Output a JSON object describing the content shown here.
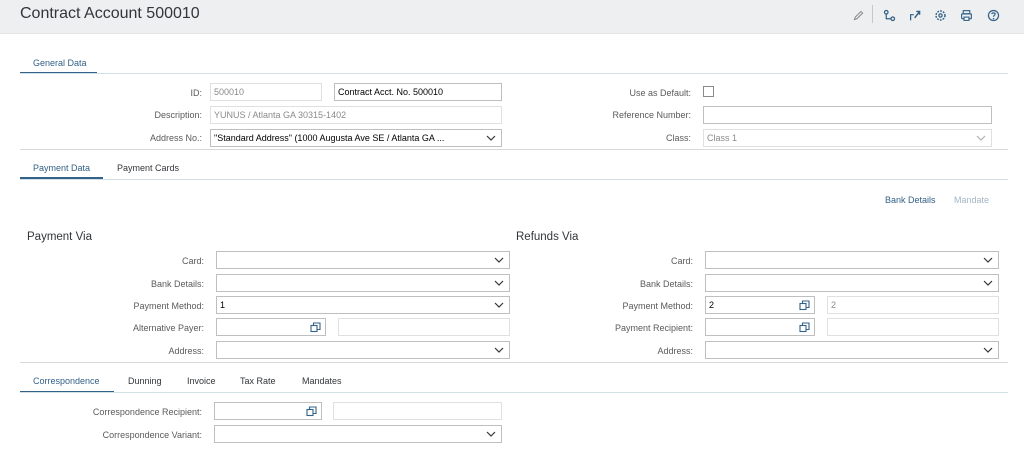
{
  "header": {
    "title": "Contract Account 500010",
    "icons": [
      "edit-icon",
      "hierarchy-icon",
      "share-icon",
      "settings-icon",
      "print-icon",
      "help-icon"
    ]
  },
  "general_section": {
    "tab": "General Data",
    "id_label": "ID:",
    "id_value": "500010",
    "name_value": "Contract Acct. No. 500010",
    "description_label": "Description:",
    "description_value": "YUNUS / Atlanta GA 30315-1402",
    "address_label": "Address No.:",
    "address_value": "\"Standard Address\"  (1000 Augusta Ave SE / Atlanta GA ...",
    "use_default_label": "Use as Default:",
    "reference_label": "Reference Number:",
    "reference_value": "",
    "class_label": "Class:",
    "class_value": "Class 1"
  },
  "payment_tabs": [
    "Payment Data",
    "Payment Cards"
  ],
  "payment_links": {
    "bank_details": "Bank Details",
    "mandate": "Mandate"
  },
  "payment_via": {
    "title": "Payment Via",
    "card_label": "Card:",
    "card_value": "",
    "bank_label": "Bank Details:",
    "bank_value": "",
    "method_label": "Payment Method:",
    "method_value": "1",
    "alt_payer_label": "Alternative Payer:",
    "alt_payer_value": "",
    "alt_payer_desc": "",
    "address_label": "Address:",
    "address_value": ""
  },
  "refunds_via": {
    "title": "Refunds Via",
    "card_label": "Card:",
    "card_value": "",
    "bank_label": "Bank Details:",
    "bank_value": "",
    "method_label": "Payment Method:",
    "method_value": "2",
    "method_desc": "2",
    "recipient_label": "Payment Recipient:",
    "recipient_value": "",
    "recipient_desc": "",
    "address_label": "Address:",
    "address_value": ""
  },
  "correspondence_tabs": [
    "Correspondence",
    "Dunning",
    "Invoice",
    "Tax Rate",
    "Mandates"
  ],
  "correspondence": {
    "recipient_label": "Correspondence Recipient:",
    "recipient_value": "",
    "recipient_desc": "",
    "variant_label": "Correspondence Variant:",
    "variant_value": ""
  },
  "colors": {
    "accent": "#346187",
    "header_bg": "#edeff0",
    "text": "#32363a",
    "label": "#5a5a5a",
    "border": "#bfbfbf"
  }
}
